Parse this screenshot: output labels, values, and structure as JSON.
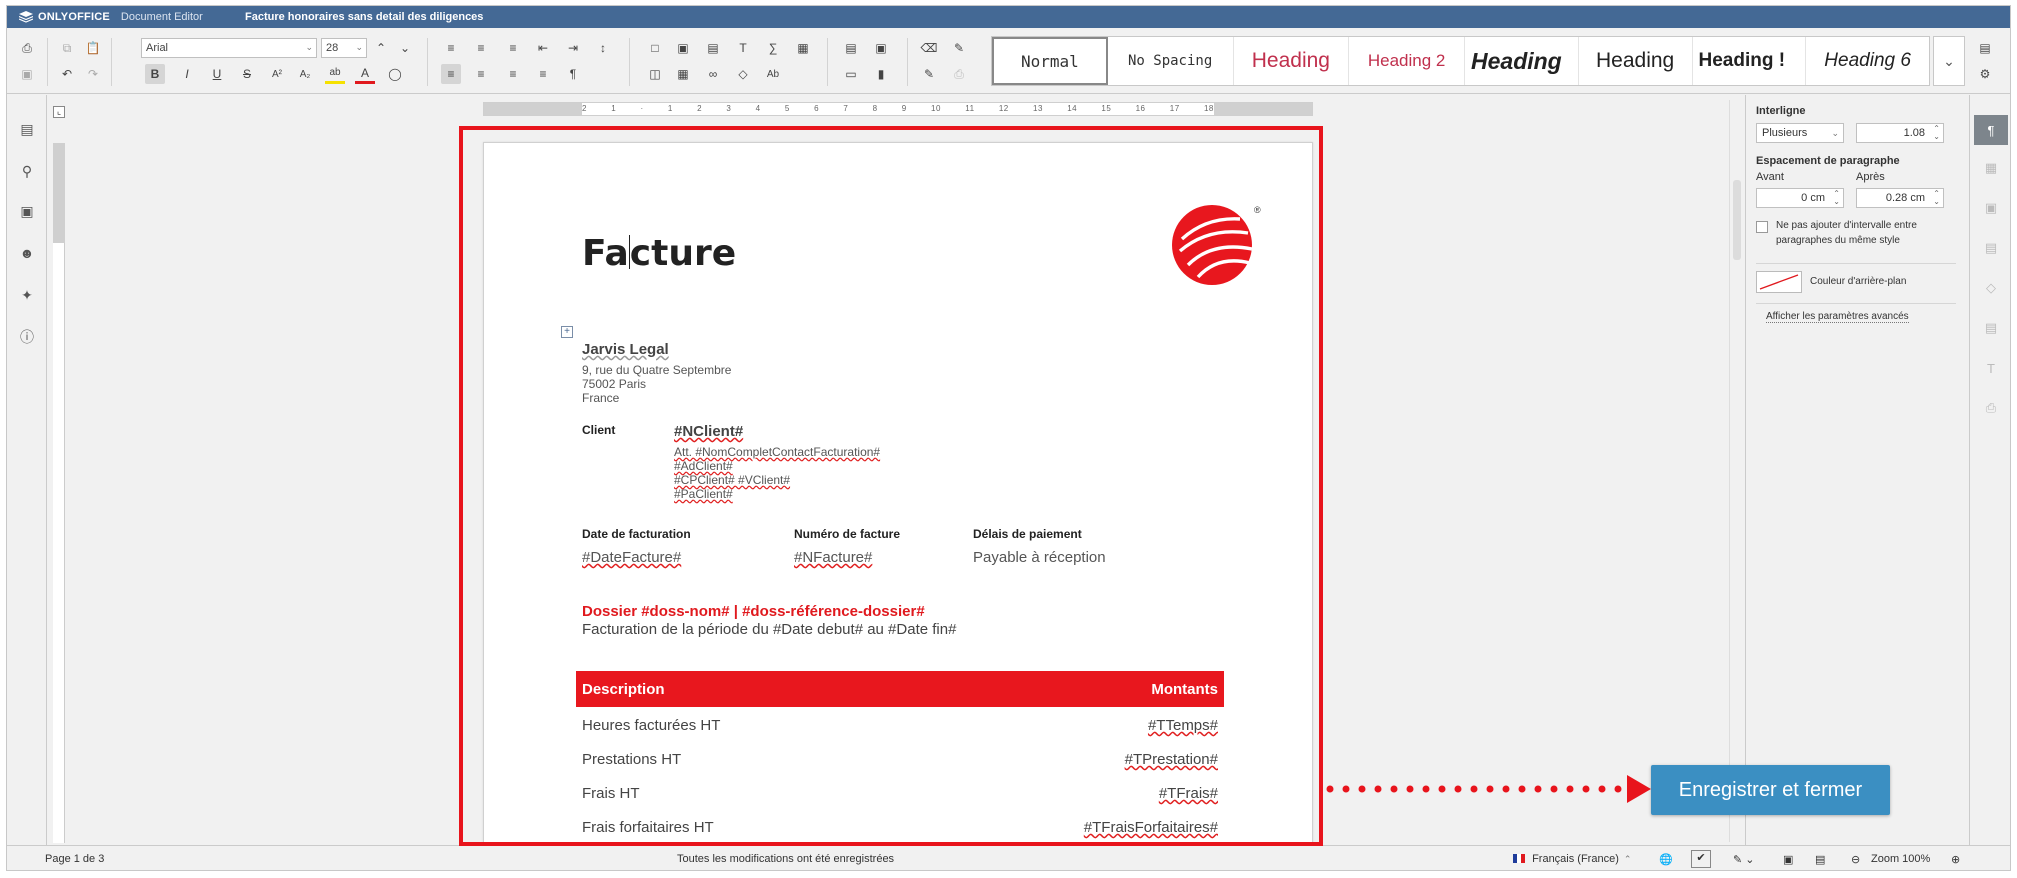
{
  "app": {
    "brand": "ONLYOFFICE",
    "product": "Document Editor",
    "document_title": "Facture honoraires sans detail des diligences"
  },
  "toolbar": {
    "font_name": "Arial",
    "font_size": "28",
    "styles": [
      "Normal",
      "No Spacing",
      "Heading",
      "Heading 2",
      "Heading",
      "Heading",
      "Heading !",
      "Heading 6"
    ]
  },
  "ruler": {
    "ticks": [
      "2",
      "1",
      "",
      "1",
      "2",
      "3",
      "4",
      "5",
      "6",
      "7",
      "8",
      "9",
      "10",
      "11",
      "12",
      "13",
      "14",
      "15",
      "16",
      "17",
      "18"
    ]
  },
  "document": {
    "title": "Facture",
    "company_name": "Jarvis Legal",
    "company_address_1": "9, rue du Quatre Septembre",
    "company_address_2": "75002 Paris",
    "company_address_3": "France",
    "client_label": "Client",
    "client_code": "#NClient#",
    "client_contact": "Att. #NomCompletContactFacturation#",
    "client_address": "#AdClient#",
    "client_city": "#CPClient# #VClient#",
    "client_country": "#PaClient#",
    "date_label": "Date de facturation",
    "date_value": "#DateFacture#",
    "number_label": "Numéro de facture",
    "number_value": "#NFacture#",
    "terms_label": "Délais de paiement",
    "terms_value": "Payable à réception",
    "dossier_line": "Dossier #doss-nom# | #doss-référence-dossier#",
    "period_line": "Facturation de la période du #Date debut# au #Date fin#",
    "table_header_left": "Description",
    "table_header_right": "Montants",
    "rows": [
      {
        "label": "Heures facturées HT",
        "value": "#TTemps#"
      },
      {
        "label": "Prestations HT",
        "value": "#TPrestation#"
      },
      {
        "label": "Frais HT",
        "value": "#TFrais#"
      },
      {
        "label": "Frais forfaitaires HT",
        "value": "#TFraisForfaitaires#"
      }
    ]
  },
  "right_panel": {
    "line_spacing_label": "Interligne",
    "line_spacing_mode": "Plusieurs",
    "line_spacing_value": "1.08",
    "paragraph_spacing_label": "Espacement de paragraphe",
    "before_label": "Avant",
    "after_label": "Après",
    "before_value": "0 cm",
    "after_value": "0.28 cm",
    "no_interval_label_1": "Ne pas ajouter d'intervalle entre",
    "no_interval_label_2": "paragraphes du même style",
    "bg_color_label": "Couleur d'arrière-plan",
    "advanced_link": "Afficher les paramètres avancés"
  },
  "status": {
    "page_info": "Page 1 de 3",
    "save_status": "Toutes les modifications ont été enregistrées",
    "language": "Français (France)",
    "zoom": "Zoom 100%"
  },
  "annotation": {
    "cta_label": "Enregistrer et fermer",
    "accent_color": "#e8141c",
    "button_color": "#3b8fc2"
  }
}
